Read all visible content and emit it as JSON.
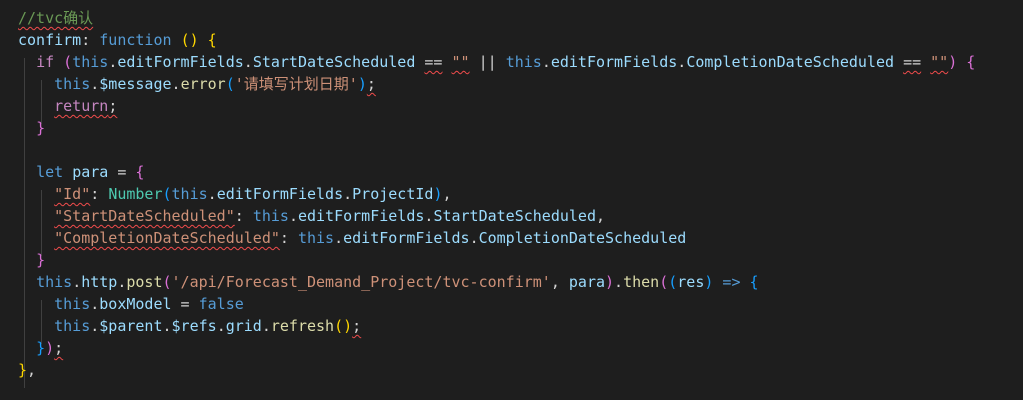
{
  "editor": {
    "language": "javascript",
    "theme": "dark",
    "colors": {
      "background": "#1e1e1e",
      "keyword": "#569cd6",
      "control": "#c586c0",
      "function": "#dcdcaa",
      "variable": "#9cdcfe",
      "type": "#4ec9b0",
      "string": "#ce9178",
      "comment": "#6a9955",
      "squiggle": "#f14c4c"
    },
    "lines": [
      {
        "tokens": [
          {
            "text": "//tvc确认",
            "kind": "cm",
            "squiggle": true
          }
        ]
      },
      {
        "tokens": [
          {
            "text": "confirm",
            "kind": "v"
          },
          {
            "text": ": ",
            "kind": "p"
          },
          {
            "text": "function",
            "kind": "k"
          },
          {
            "text": " ",
            "kind": "p"
          },
          {
            "text": "()",
            "kind": "b1"
          },
          {
            "text": " ",
            "kind": "p"
          },
          {
            "text": "{",
            "kind": "b1"
          }
        ]
      },
      {
        "tokens": [
          {
            "text": "  ",
            "kind": "p"
          },
          {
            "text": "if",
            "kind": "c"
          },
          {
            "text": " ",
            "kind": "p"
          },
          {
            "text": "(",
            "kind": "b2"
          },
          {
            "text": "this",
            "kind": "k"
          },
          {
            "text": ".",
            "kind": "p"
          },
          {
            "text": "editFormFields",
            "kind": "v"
          },
          {
            "text": ".",
            "kind": "p"
          },
          {
            "text": "StartDateScheduled",
            "kind": "v"
          },
          {
            "text": " ",
            "kind": "p"
          },
          {
            "text": "==",
            "kind": "p",
            "squiggle": true
          },
          {
            "text": " ",
            "kind": "p"
          },
          {
            "text": "\"\"",
            "kind": "s",
            "squiggle": true
          },
          {
            "text": " || ",
            "kind": "p"
          },
          {
            "text": "this",
            "kind": "k"
          },
          {
            "text": ".",
            "kind": "p"
          },
          {
            "text": "editFormFields",
            "kind": "v"
          },
          {
            "text": ".",
            "kind": "p"
          },
          {
            "text": "CompletionDateScheduled",
            "kind": "v"
          },
          {
            "text": " ",
            "kind": "p"
          },
          {
            "text": "==",
            "kind": "p",
            "squiggle": true
          },
          {
            "text": " ",
            "kind": "p"
          },
          {
            "text": "\"\"",
            "kind": "s",
            "squiggle": true
          },
          {
            "text": ")",
            "kind": "b2"
          },
          {
            "text": " ",
            "kind": "p"
          },
          {
            "text": "{",
            "kind": "b2"
          }
        ]
      },
      {
        "tokens": [
          {
            "text": "    ",
            "kind": "p"
          },
          {
            "text": "this",
            "kind": "k"
          },
          {
            "text": ".",
            "kind": "p"
          },
          {
            "text": "$message",
            "kind": "v"
          },
          {
            "text": ".",
            "kind": "p"
          },
          {
            "text": "error",
            "kind": "f"
          },
          {
            "text": "(",
            "kind": "b3"
          },
          {
            "text": "'请填写计划日期'",
            "kind": "s"
          },
          {
            "text": ")",
            "kind": "b3"
          },
          {
            "text": ";",
            "kind": "p",
            "squiggle": true
          }
        ]
      },
      {
        "tokens": [
          {
            "text": "    ",
            "kind": "p"
          },
          {
            "text": "return",
            "kind": "c",
            "squiggle": true
          },
          {
            "text": ";",
            "kind": "p",
            "squiggle": true
          }
        ]
      },
      {
        "tokens": [
          {
            "text": "  ",
            "kind": "p"
          },
          {
            "text": "}",
            "kind": "b2"
          }
        ]
      },
      {
        "tokens": [
          {
            "text": "",
            "kind": "p"
          }
        ]
      },
      {
        "tokens": [
          {
            "text": "  ",
            "kind": "p"
          },
          {
            "text": "let",
            "kind": "k"
          },
          {
            "text": " ",
            "kind": "p"
          },
          {
            "text": "para",
            "kind": "v"
          },
          {
            "text": " = ",
            "kind": "p"
          },
          {
            "text": "{",
            "kind": "b2"
          }
        ]
      },
      {
        "tokens": [
          {
            "text": "    ",
            "kind": "p"
          },
          {
            "text": "\"Id\"",
            "kind": "s",
            "squiggle": true
          },
          {
            "text": ": ",
            "kind": "p"
          },
          {
            "text": "Number",
            "kind": "t"
          },
          {
            "text": "(",
            "kind": "b3"
          },
          {
            "text": "this",
            "kind": "k"
          },
          {
            "text": ".",
            "kind": "p"
          },
          {
            "text": "editFormFields",
            "kind": "v"
          },
          {
            "text": ".",
            "kind": "p"
          },
          {
            "text": "ProjectId",
            "kind": "v"
          },
          {
            "text": ")",
            "kind": "b3"
          },
          {
            "text": ",",
            "kind": "p"
          }
        ]
      },
      {
        "tokens": [
          {
            "text": "    ",
            "kind": "p"
          },
          {
            "text": "\"StartDateScheduled\"",
            "kind": "s",
            "squiggle": true
          },
          {
            "text": ": ",
            "kind": "p"
          },
          {
            "text": "this",
            "kind": "k"
          },
          {
            "text": ".",
            "kind": "p"
          },
          {
            "text": "editFormFields",
            "kind": "v"
          },
          {
            "text": ".",
            "kind": "p"
          },
          {
            "text": "StartDateScheduled",
            "kind": "v"
          },
          {
            "text": ",",
            "kind": "p"
          }
        ]
      },
      {
        "tokens": [
          {
            "text": "    ",
            "kind": "p"
          },
          {
            "text": "\"CompletionDateScheduled\"",
            "kind": "s",
            "squiggle": true
          },
          {
            "text": ": ",
            "kind": "p"
          },
          {
            "text": "this",
            "kind": "k"
          },
          {
            "text": ".",
            "kind": "p"
          },
          {
            "text": "editFormFields",
            "kind": "v"
          },
          {
            "text": ".",
            "kind": "p"
          },
          {
            "text": "CompletionDateScheduled",
            "kind": "v"
          }
        ]
      },
      {
        "tokens": [
          {
            "text": "  ",
            "kind": "p"
          },
          {
            "text": "}",
            "kind": "b2"
          }
        ]
      },
      {
        "tokens": [
          {
            "text": "  ",
            "kind": "p"
          },
          {
            "text": "this",
            "kind": "k"
          },
          {
            "text": ".",
            "kind": "p"
          },
          {
            "text": "http",
            "kind": "v"
          },
          {
            "text": ".",
            "kind": "p"
          },
          {
            "text": "post",
            "kind": "f"
          },
          {
            "text": "(",
            "kind": "b2"
          },
          {
            "text": "'/api/Forecast_Demand_Project/tvc-confirm'",
            "kind": "s"
          },
          {
            "text": ", ",
            "kind": "p"
          },
          {
            "text": "para",
            "kind": "v"
          },
          {
            "text": ")",
            "kind": "b2"
          },
          {
            "text": ".",
            "kind": "p"
          },
          {
            "text": "then",
            "kind": "f"
          },
          {
            "text": "(",
            "kind": "b2"
          },
          {
            "text": "(",
            "kind": "b3"
          },
          {
            "text": "res",
            "kind": "v"
          },
          {
            "text": ")",
            "kind": "b3"
          },
          {
            "text": " ",
            "kind": "p"
          },
          {
            "text": "=>",
            "kind": "k"
          },
          {
            "text": " ",
            "kind": "p"
          },
          {
            "text": "{",
            "kind": "b3"
          }
        ]
      },
      {
        "tokens": [
          {
            "text": "    ",
            "kind": "p"
          },
          {
            "text": "this",
            "kind": "k"
          },
          {
            "text": ".",
            "kind": "p"
          },
          {
            "text": "boxModel",
            "kind": "v"
          },
          {
            "text": " = ",
            "kind": "p"
          },
          {
            "text": "false",
            "kind": "k"
          }
        ]
      },
      {
        "tokens": [
          {
            "text": "    ",
            "kind": "p"
          },
          {
            "text": "this",
            "kind": "k"
          },
          {
            "text": ".",
            "kind": "p"
          },
          {
            "text": "$parent",
            "kind": "v"
          },
          {
            "text": ".",
            "kind": "p"
          },
          {
            "text": "$refs",
            "kind": "v"
          },
          {
            "text": ".",
            "kind": "p"
          },
          {
            "text": "grid",
            "kind": "v"
          },
          {
            "text": ".",
            "kind": "p"
          },
          {
            "text": "refresh",
            "kind": "f"
          },
          {
            "text": "()",
            "kind": "b1"
          },
          {
            "text": ";",
            "kind": "p",
            "squiggle": true
          }
        ]
      },
      {
        "tokens": [
          {
            "text": "  ",
            "kind": "p"
          },
          {
            "text": "}",
            "kind": "b3"
          },
          {
            "text": ")",
            "kind": "b2"
          },
          {
            "text": ";",
            "kind": "p",
            "squiggle": true
          }
        ]
      },
      {
        "tokens": [
          {
            "text": "}",
            "kind": "b1"
          },
          {
            "text": ",",
            "kind": "p"
          }
        ]
      }
    ]
  }
}
